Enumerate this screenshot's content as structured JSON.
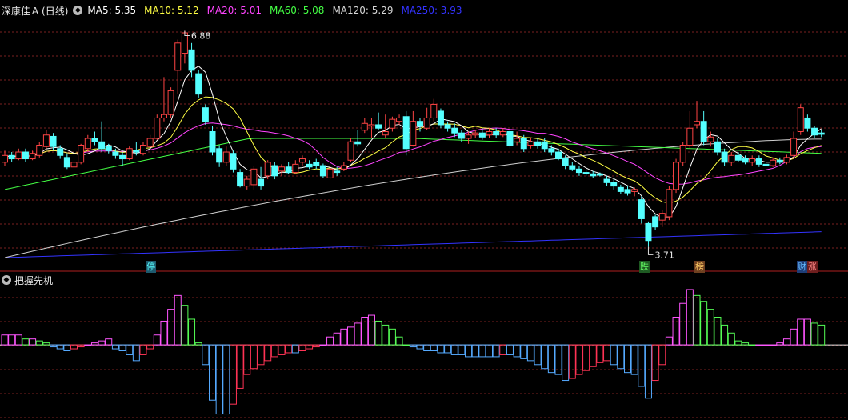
{
  "header": {
    "stock_name": "深康佳Ａ",
    "period": "(日线)",
    "ma": [
      {
        "label": "MA5: 5.35",
        "color": "#ffffff"
      },
      {
        "label": "MA10: 5.12",
        "color": "#ffff44"
      },
      {
        "label": "MA20: 5.01",
        "color": "#ff44ff"
      },
      {
        "label": "MA60: 5.08",
        "color": "#44ff44"
      },
      {
        "label": "MA120: 5.29",
        "color": "#d8d8d8"
      },
      {
        "label": "MA250: 3.93",
        "color": "#3333ff"
      }
    ]
  },
  "indicator": {
    "title": "把握先机"
  },
  "annotations": {
    "high_label": "6.88",
    "low_label": "3.71"
  },
  "badges": [
    {
      "text": "停",
      "bg": "#1e5a6e",
      "color": "#55ffff"
    },
    {
      "text": "跌",
      "bg": "#1e5a22",
      "color": "#66ff66"
    },
    {
      "text": "榜",
      "bg": "#6e4020",
      "color": "#ffcc66"
    },
    {
      "text": "财",
      "bg": "#1e3e78",
      "color": "#66bbff"
    },
    {
      "text": "涨",
      "bg": "#6e1e1e",
      "color": "#ff8888"
    }
  ],
  "colors": {
    "up": "#ff4444",
    "down": "#54ffff",
    "grid": "#7a1f1f",
    "ind_pos_up": "#ff55ff",
    "ind_pos_down": "#55ff55",
    "ind_neg_down": "#55aaff",
    "ind_neg_up": "#ff3355"
  },
  "chart_data": {
    "type": "candlestick",
    "y_range": [
      3.55,
      7.05
    ],
    "candles": [
      [
        4.95,
        5.05,
        5.12,
        4.9
      ],
      [
        5.05,
        5.0,
        5.1,
        4.95
      ],
      [
        5.0,
        5.1,
        5.15,
        4.98
      ],
      [
        5.1,
        5.0,
        5.15,
        4.95
      ],
      [
        5.0,
        5.08,
        5.12,
        4.98
      ],
      [
        5.05,
        5.2,
        5.25,
        5.02
      ],
      [
        5.18,
        5.35,
        5.42,
        5.15
      ],
      [
        5.33,
        5.18,
        5.38,
        5.12
      ],
      [
        5.15,
        5.05,
        5.2,
        5.0
      ],
      [
        5.02,
        4.88,
        5.08,
        4.85
      ],
      [
        4.88,
        4.95,
        5.02,
        4.85
      ],
      [
        4.95,
        5.2,
        5.22,
        4.92
      ],
      [
        5.15,
        5.3,
        5.35,
        5.1
      ],
      [
        5.3,
        5.25,
        5.4,
        5.2
      ],
      [
        5.25,
        5.15,
        5.55,
        5.1
      ],
      [
        5.18,
        5.12,
        5.22,
        5.08
      ],
      [
        5.1,
        5.05,
        5.15,
        5.0
      ],
      [
        5.05,
        5.0,
        5.1,
        4.9
      ],
      [
        5.0,
        5.15,
        5.18,
        4.98
      ],
      [
        5.12,
        5.1,
        5.25,
        5.05
      ],
      [
        5.08,
        5.2,
        5.25,
        5.05
      ],
      [
        5.18,
        5.3,
        5.35,
        5.15
      ],
      [
        5.3,
        5.6,
        5.65,
        5.28
      ],
      [
        5.6,
        5.65,
        6.2,
        5.55
      ],
      [
        5.65,
        6.0,
        6.05,
        5.6
      ],
      [
        6.3,
        6.7,
        6.75,
        5.95
      ],
      [
        6.55,
        6.85,
        6.88,
        6.4
      ],
      [
        6.6,
        6.3,
        6.7,
        6.2
      ],
      [
        6.25,
        5.95,
        6.3,
        5.9
      ],
      [
        5.75,
        5.55,
        5.8,
        5.5
      ],
      [
        5.4,
        5.1,
        5.48,
        5.05
      ],
      [
        5.15,
        4.95,
        5.2,
        4.88
      ],
      [
        4.95,
        5.1,
        5.18,
        4.9
      ],
      [
        5.08,
        4.85,
        5.12,
        4.8
      ],
      [
        4.8,
        4.6,
        4.85,
        4.58
      ],
      [
        4.6,
        4.7,
        4.75,
        4.55
      ],
      [
        4.62,
        4.85,
        4.9,
        4.55
      ],
      [
        4.7,
        4.6,
        4.88,
        4.55
      ],
      [
        4.75,
        4.95,
        4.98,
        4.7
      ],
      [
        4.9,
        4.75,
        4.95,
        4.7
      ],
      [
        4.82,
        4.88,
        4.92,
        4.75
      ],
      [
        4.88,
        4.8,
        4.95,
        4.78
      ],
      [
        4.8,
        4.92,
        4.98,
        4.78
      ],
      [
        4.95,
        5.0,
        5.05,
        4.9
      ],
      [
        4.92,
        4.88,
        4.98,
        4.85
      ],
      [
        4.95,
        4.9,
        5.0,
        4.85
      ],
      [
        4.9,
        4.75,
        4.93,
        4.72
      ],
      [
        4.72,
        4.85,
        4.9,
        4.7
      ],
      [
        4.82,
        4.8,
        4.88,
        4.75
      ],
      [
        4.85,
        4.9,
        4.95,
        4.82
      ],
      [
        4.98,
        5.25,
        5.3,
        4.95
      ],
      [
        5.25,
        5.22,
        5.42,
        5.18
      ],
      [
        5.42,
        5.52,
        5.6,
        5.38
      ],
      [
        5.48,
        5.5,
        5.6,
        5.3
      ],
      [
        5.5,
        5.45,
        5.68,
        5.42
      ],
      [
        5.35,
        5.4,
        5.65,
        5.3
      ],
      [
        5.45,
        5.58,
        5.62,
        5.4
      ],
      [
        5.55,
        5.6,
        5.65,
        5.5
      ],
      [
        5.62,
        5.15,
        5.7,
        5.05
      ],
      [
        5.2,
        5.55,
        5.7,
        5.18
      ],
      [
        5.55,
        5.48,
        5.6,
        5.4
      ],
      [
        5.45,
        5.6,
        5.75,
        5.42
      ],
      [
        5.6,
        5.8,
        5.88,
        5.55
      ],
      [
        5.7,
        5.5,
        5.74,
        5.45
      ],
      [
        5.5,
        5.45,
        5.55,
        5.4
      ],
      [
        5.45,
        5.38,
        5.52,
        5.32
      ],
      [
        5.38,
        5.3,
        5.42,
        5.25
      ],
      [
        5.3,
        5.35,
        5.4,
        5.22
      ],
      [
        5.35,
        5.38,
        5.42,
        5.3
      ],
      [
        5.38,
        5.32,
        5.45,
        5.28
      ],
      [
        5.35,
        5.4,
        5.45,
        5.3
      ],
      [
        5.4,
        5.35,
        5.45,
        5.3
      ],
      [
        5.35,
        5.4,
        5.45,
        5.32
      ],
      [
        5.4,
        5.2,
        5.44,
        5.15
      ],
      [
        5.25,
        5.3,
        5.4,
        5.2
      ],
      [
        5.3,
        5.15,
        5.35,
        5.1
      ],
      [
        5.2,
        5.25,
        5.3,
        5.15
      ],
      [
        5.25,
        5.2,
        5.3,
        5.15
      ],
      [
        5.25,
        5.15,
        5.3,
        5.1
      ],
      [
        5.15,
        5.1,
        5.2,
        5.05
      ],
      [
        5.1,
        5.0,
        5.15,
        4.98
      ],
      [
        5.0,
        4.9,
        5.05,
        4.85
      ],
      [
        4.9,
        4.85,
        4.95,
        4.82
      ],
      [
        4.85,
        4.8,
        4.9,
        4.75
      ],
      [
        4.8,
        4.78,
        4.85,
        4.75
      ],
      [
        4.78,
        4.75,
        4.82,
        4.72
      ],
      [
        4.78,
        4.76,
        4.8,
        4.74
      ],
      [
        4.7,
        4.65,
        4.75,
        4.6
      ],
      [
        4.65,
        4.6,
        4.7,
        4.55
      ],
      [
        4.58,
        4.52,
        4.62,
        4.48
      ],
      [
        4.55,
        4.5,
        4.6,
        4.46
      ],
      [
        4.52,
        4.55,
        4.58,
        4.45
      ],
      [
        4.4,
        4.12,
        4.45,
        4.05
      ],
      [
        4.05,
        3.8,
        4.08,
        3.71
      ],
      [
        4.15,
        4.0,
        4.18,
        3.95
      ],
      [
        4.1,
        4.2,
        4.25,
        4.0
      ],
      [
        4.15,
        4.55,
        4.6,
        4.1
      ],
      [
        4.55,
        4.95,
        5.0,
        4.5
      ],
      [
        4.95,
        5.2,
        5.25,
        4.9
      ],
      [
        5.2,
        5.45,
        5.7,
        5.15
      ],
      [
        5.5,
        5.55,
        5.85,
        5.45
      ],
      [
        5.55,
        5.25,
        5.7,
        5.2
      ],
      [
        5.25,
        5.32,
        5.4,
        5.18
      ],
      [
        5.25,
        5.1,
        5.3,
        5.05
      ],
      [
        5.1,
        4.95,
        5.15,
        4.9
      ],
      [
        4.95,
        5.05,
        5.1,
        4.9
      ],
      [
        5.05,
        4.98,
        5.1,
        4.95
      ],
      [
        5.0,
        4.95,
        5.05,
        4.92
      ],
      [
        4.95,
        5.0,
        5.05,
        4.9
      ],
      [
        5.0,
        4.92,
        5.05,
        4.88
      ],
      [
        4.92,
        4.9,
        4.96,
        4.88
      ],
      [
        4.9,
        4.98,
        5.02,
        4.88
      ],
      [
        4.98,
        4.95,
        5.02,
        4.92
      ],
      [
        4.95,
        5.02,
        5.06,
        4.92
      ],
      [
        5.05,
        5.3,
        5.4,
        5.0
      ],
      [
        5.4,
        5.75,
        5.8,
        5.35
      ],
      [
        5.6,
        5.45,
        5.65,
        5.4
      ],
      [
        5.45,
        5.35,
        5.48,
        5.3
      ],
      [
        5.38,
        5.36,
        5.42,
        5.32
      ]
    ],
    "indicator_values": [
      0.05,
      0.05,
      0.05,
      0.03,
      0.03,
      0.02,
      0.01,
      -0.01,
      -0.02,
      -0.03,
      -0.02,
      -0.01,
      0.0,
      0.01,
      0.02,
      0.03,
      -0.02,
      -0.03,
      -0.05,
      -0.08,
      -0.05,
      -0.02,
      0.05,
      0.12,
      0.18,
      0.25,
      0.2,
      0.13,
      0.01,
      -0.1,
      -0.28,
      -0.35,
      -0.35,
      -0.3,
      -0.22,
      -0.15,
      -0.12,
      -0.1,
      -0.08,
      -0.06,
      -0.05,
      -0.04,
      -0.04,
      -0.03,
      -0.02,
      -0.01,
      0.0,
      0.04,
      0.06,
      0.08,
      0.09,
      0.11,
      0.14,
      0.15,
      0.12,
      0.1,
      0.08,
      0.04,
      0.0,
      -0.01,
      -0.02,
      -0.03,
      -0.03,
      -0.04,
      -0.04,
      -0.05,
      -0.05,
      -0.06,
      -0.06,
      -0.06,
      -0.06,
      -0.06,
      -0.05,
      -0.05,
      -0.06,
      -0.07,
      -0.08,
      -0.1,
      -0.12,
      -0.14,
      -0.15,
      -0.18,
      -0.17,
      -0.15,
      -0.13,
      -0.11,
      -0.09,
      -0.08,
      -0.1,
      -0.12,
      -0.14,
      -0.15,
      -0.21,
      -0.27,
      -0.18,
      -0.1,
      0.04,
      0.14,
      0.21,
      0.28,
      0.25,
      0.22,
      0.18,
      0.14,
      0.1,
      0.06,
      0.02,
      0.01,
      0.0,
      0.0,
      0.0,
      0.0,
      0.01,
      0.03,
      0.08,
      0.13,
      0.13,
      0.11,
      0.1
    ],
    "ind_range": [
      -0.36,
      0.3
    ]
  }
}
